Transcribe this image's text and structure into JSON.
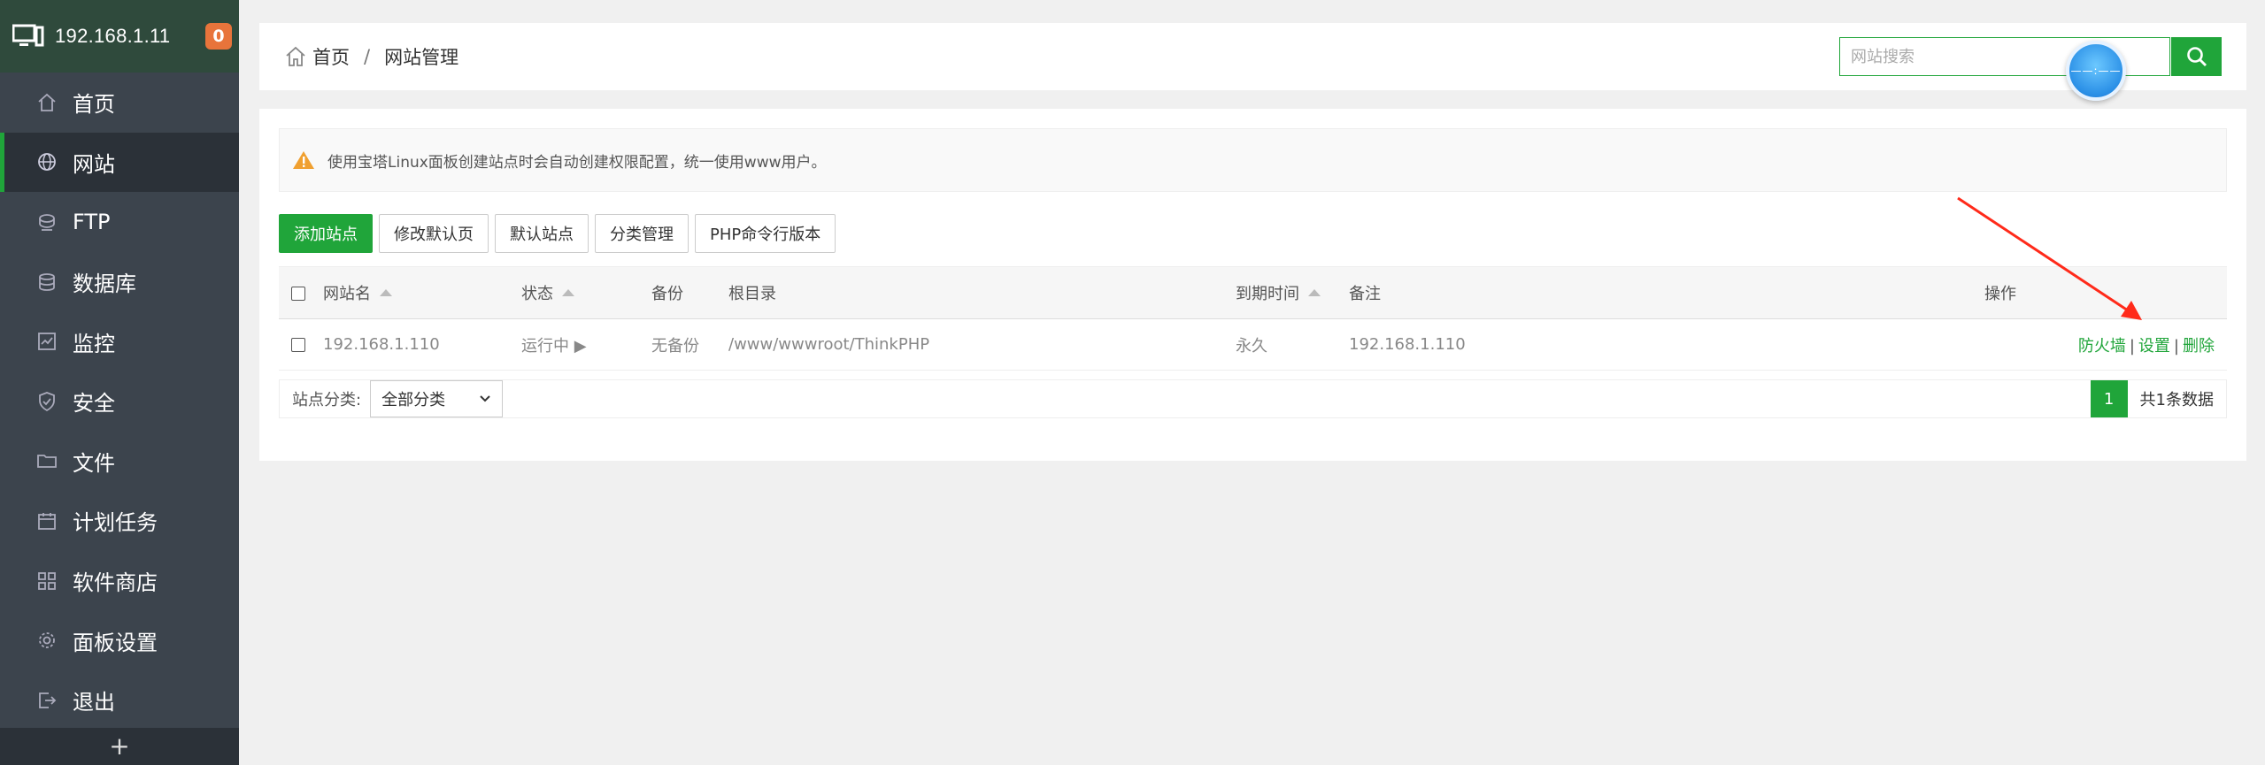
{
  "sidebar": {
    "ip": "192.168.1.11",
    "badge": "0",
    "items": [
      {
        "label": "首页",
        "icon": "home-icon"
      },
      {
        "label": "网站",
        "icon": "globe-icon"
      },
      {
        "label": "FTP",
        "icon": "ftp-icon"
      },
      {
        "label": "数据库",
        "icon": "database-icon"
      },
      {
        "label": "监控",
        "icon": "monitor-icon"
      },
      {
        "label": "安全",
        "icon": "shield-icon"
      },
      {
        "label": "文件",
        "icon": "folder-icon"
      },
      {
        "label": "计划任务",
        "icon": "calendar-icon"
      },
      {
        "label": "软件商店",
        "icon": "apps-icon"
      },
      {
        "label": "面板设置",
        "icon": "gear-icon"
      },
      {
        "label": "退出",
        "icon": "logout-icon"
      }
    ],
    "active_index": 1,
    "add_label": "+"
  },
  "breadcrumb": {
    "home": "首页",
    "separator": "/",
    "current": "网站管理"
  },
  "search": {
    "placeholder": "网站搜索"
  },
  "float_widget": "——:——",
  "alert": {
    "text": "使用宝塔Linux面板创建站点时会自动创建权限配置，统一使用www用户。"
  },
  "toolbar": {
    "add_site": "添加站点",
    "edit_default_page": "修改默认页",
    "default_site": "默认站点",
    "category_manage": "分类管理",
    "php_cli_version": "PHP命令行版本"
  },
  "table": {
    "headers": {
      "name": "网站名",
      "status": "状态",
      "backup": "备份",
      "root": "根目录",
      "expire": "到期时间",
      "remark": "备注",
      "actions": "操作"
    },
    "rows": [
      {
        "name": "192.168.1.110",
        "status": "运行中 ▶",
        "backup": "无备份",
        "root": "/www/wwwroot/ThinkPHP",
        "expire": "永久",
        "remark": "192.168.1.110",
        "actions": [
          "防火墙",
          "设置",
          "删除"
        ]
      }
    ]
  },
  "footer": {
    "category_label": "站点分类:",
    "category_value": "全部分类",
    "page": "1",
    "total": "共1条数据"
  },
  "colors": {
    "accent": "#20a53a",
    "sidebar_bg": "#3c444d",
    "sidebar_header_bg": "#2f4a3c",
    "badge": "#e8743b",
    "annotation_arrow": "#ff2a1a"
  }
}
